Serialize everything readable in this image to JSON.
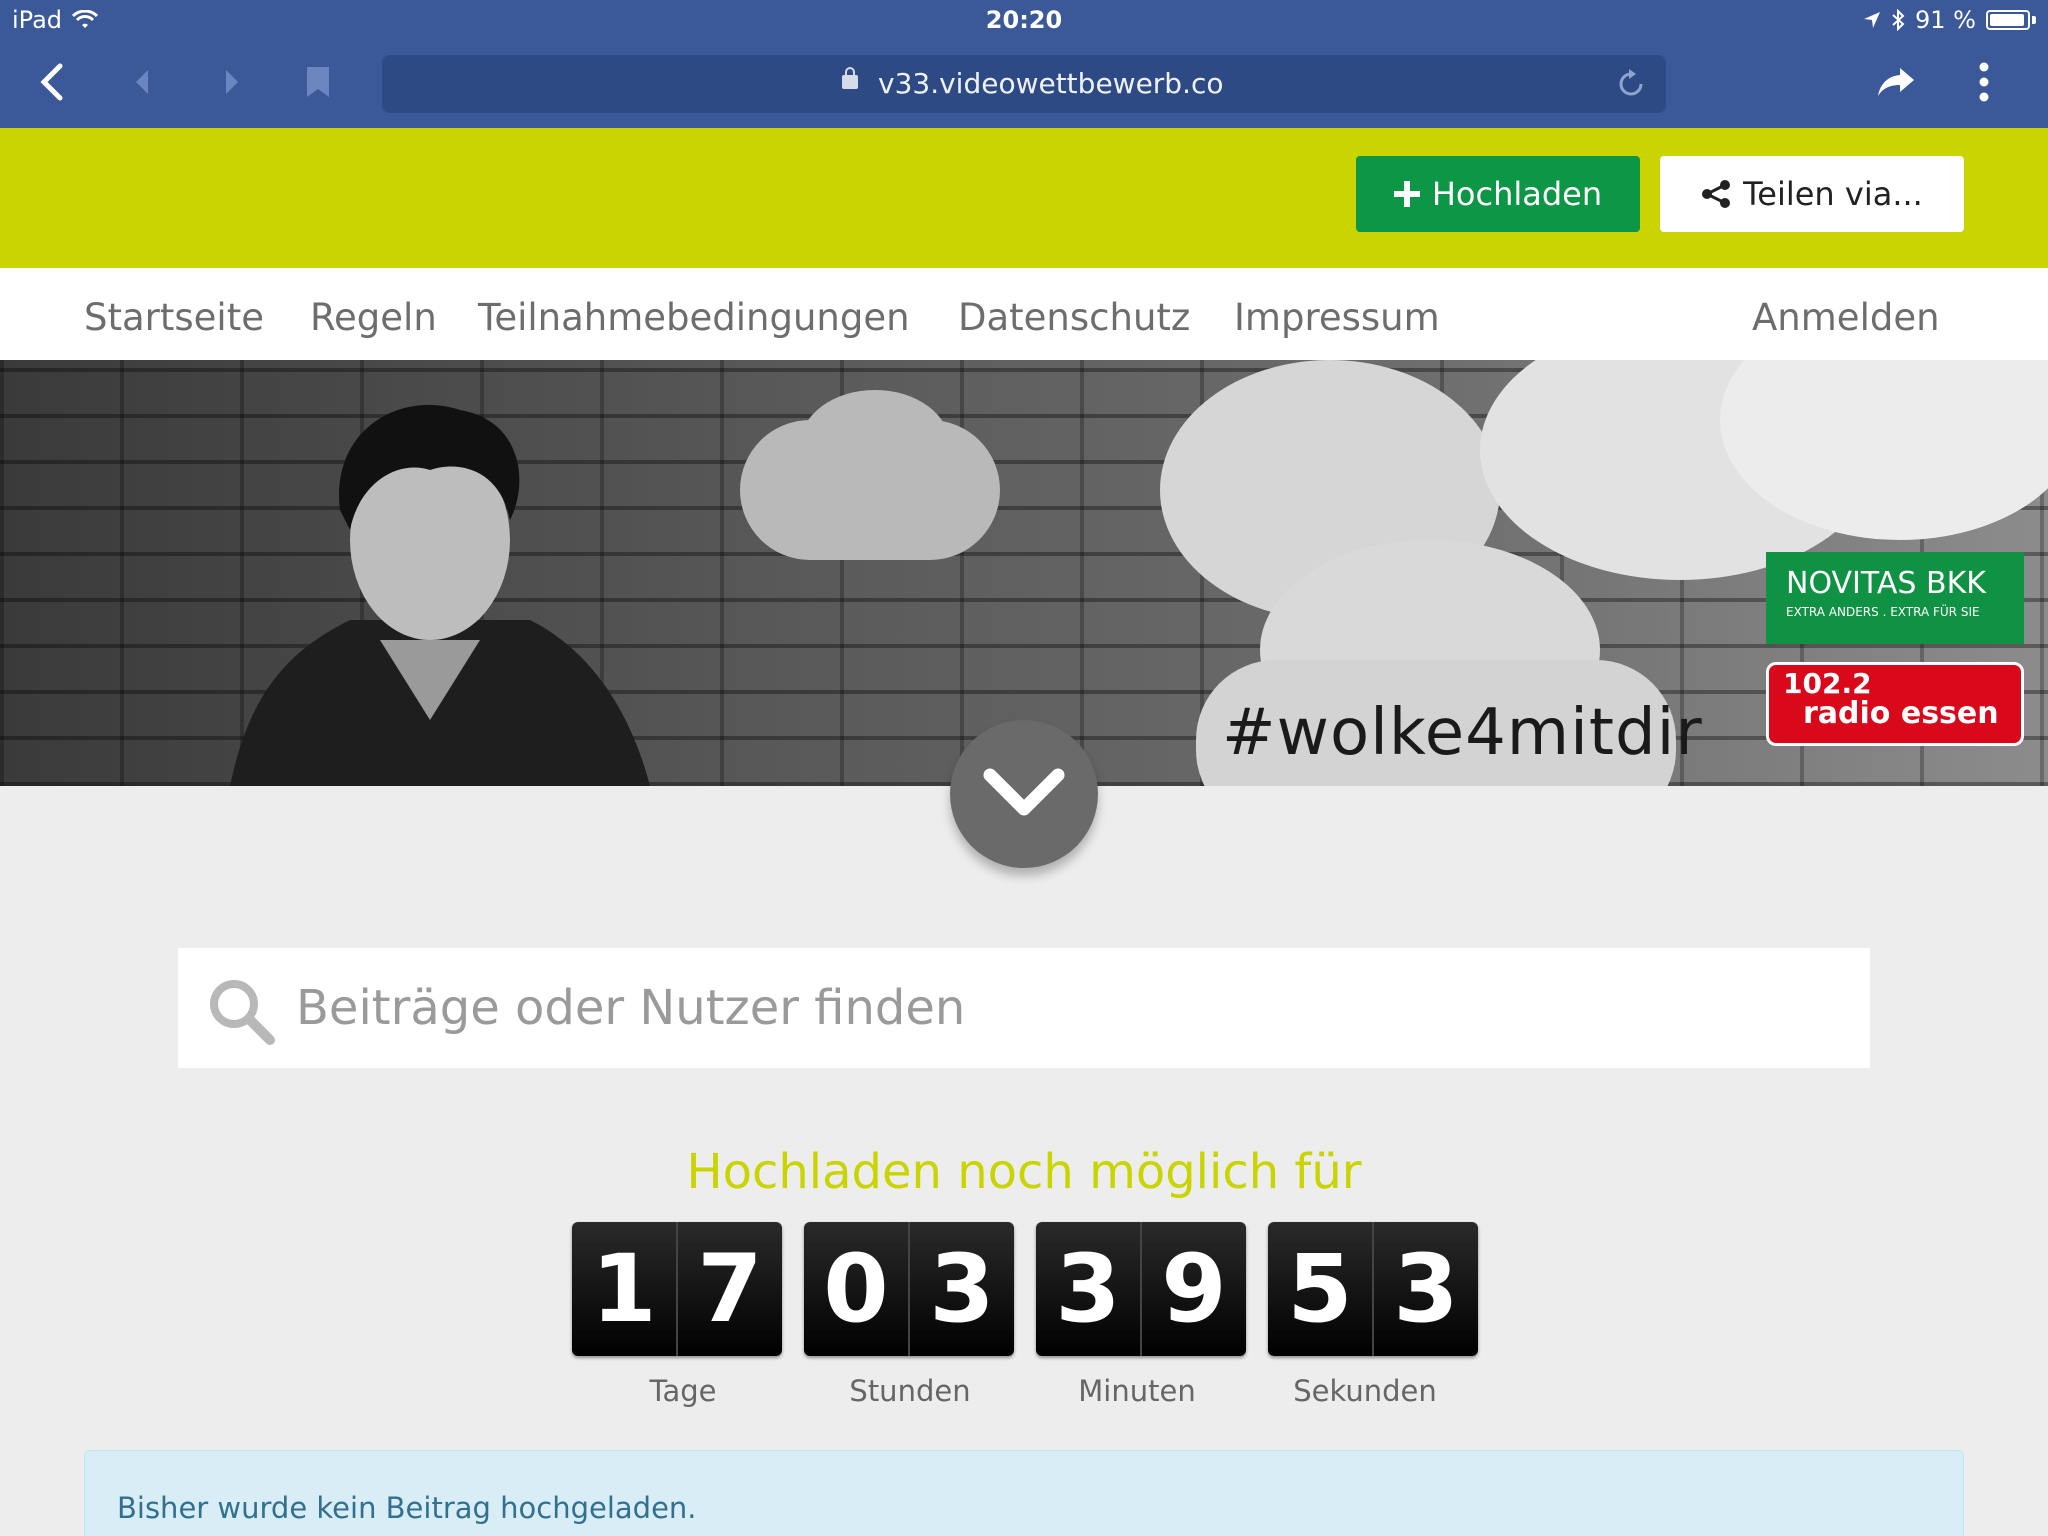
{
  "status_bar": {
    "device": "iPad",
    "time": "20:20",
    "battery": "91 %"
  },
  "browser": {
    "url": "v33.videowettbewerb.co"
  },
  "header": {
    "upload_label": "Hochladen",
    "share_label": "Teilen via..."
  },
  "nav": {
    "items": [
      "Startseite",
      "Regeln",
      "Teilnahmebedingungen",
      "Datenschutz",
      "Impressum"
    ],
    "login": "Anmelden"
  },
  "banner": {
    "hashtag": "#wolke4mitdir",
    "sponsor1": {
      "name": "NOVITAS BKK",
      "tagline": "EXTRA ANDERS . EXTRA FÜR SIE"
    },
    "sponsor2": {
      "line1": "102.2",
      "line2": "radio essen"
    }
  },
  "search": {
    "placeholder": "Beiträge oder Nutzer finden"
  },
  "countdown": {
    "title": "Hochladen noch möglich für",
    "units": [
      {
        "label": "Tage",
        "digits": [
          "1",
          "7"
        ]
      },
      {
        "label": "Stunden",
        "digits": [
          "0",
          "3"
        ]
      },
      {
        "label": "Minuten",
        "digits": [
          "3",
          "9"
        ]
      },
      {
        "label": "Sekunden",
        "digits": [
          "5",
          "3"
        ]
      }
    ]
  },
  "notice": {
    "text": "Bisher wurde kein Beitrag hochgeladen."
  },
  "colors": {
    "browser_bar": "#3b5998",
    "header_green": "#c9d400",
    "upload_button": "#0e9647",
    "countdown_title": "#c9d400",
    "info_background": "#d9edf7"
  }
}
